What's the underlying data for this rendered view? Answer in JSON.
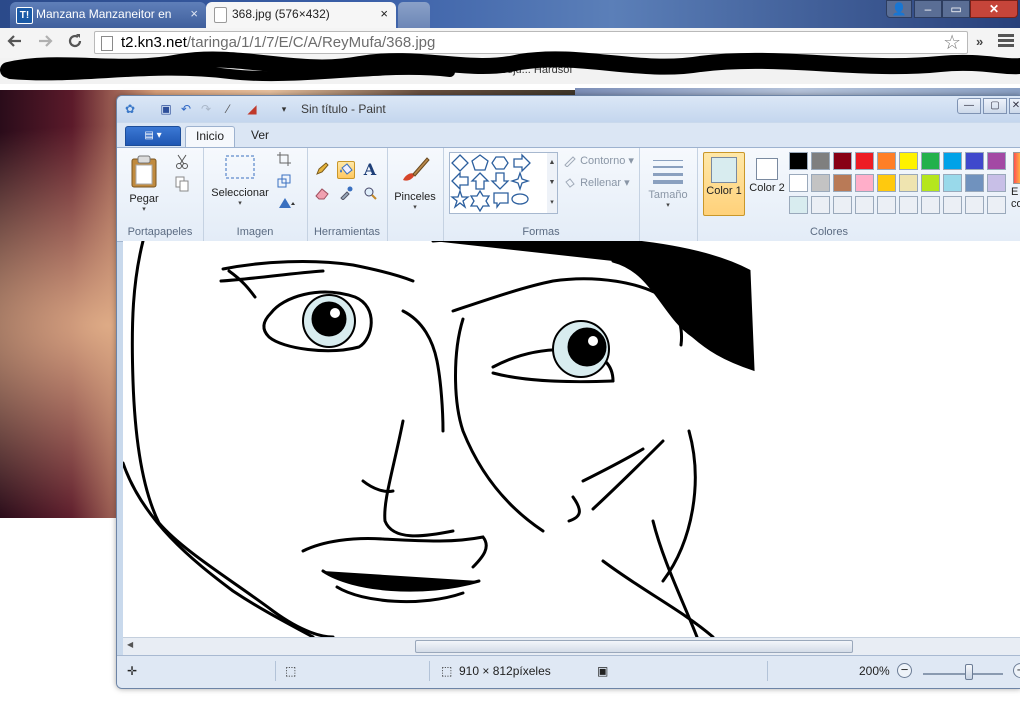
{
  "browser": {
    "tabs": [
      {
        "title": "Manzana Manzaneitor en",
        "favicon": "T!",
        "close": "×"
      },
      {
        "title": "368.jpg (576×432)",
        "close": "×"
      }
    ],
    "window_controls": {
      "user": "👤",
      "minimize": "–",
      "maximize": "▭",
      "close": "✕"
    },
    "url_host": "t2.kn3.net",
    "url_path": "/taringa/1/1/7/E/C/A/ReyMufa/368.jpg",
    "star_icon": "☆",
    "overflow": "»",
    "bookmark_partial": "e Videoju...      Hardsof"
  },
  "paint": {
    "title": "Sin título - Paint",
    "quick_access": {
      "app": "✿",
      "save": "▣",
      "undo": "↶",
      "redo": "↷",
      "picker": "⁄",
      "color": "◢",
      "more": "▾"
    },
    "window_controls": {
      "minimize": "—",
      "maximize": "▢",
      "close": "✕"
    },
    "menu_button": "▤ ▾",
    "tabs": {
      "home": "Inicio",
      "view": "Ver"
    },
    "groups": {
      "clipboard": {
        "label": "Portapapeles",
        "paste": "Pegar",
        "dropdown": "▾"
      },
      "image": {
        "label": "Imagen",
        "select": "Seleccionar",
        "dropdown": "▾"
      },
      "tools": {
        "label": "Herramientas",
        "text_tool": "A"
      },
      "brushes": {
        "label": "Pinceles",
        "dropdown": "▾"
      },
      "shapes": {
        "label": "Formas",
        "outline": "Contorno",
        "fill": "Rellenar",
        "outline_caret": "▾",
        "fill_caret": "▾"
      },
      "size": {
        "label": "Tamaño",
        "dropdown": "▾"
      },
      "colors": {
        "label": "Colores",
        "color1": "Color 1",
        "color2": "Color 2",
        "edit_partial": "E co"
      }
    },
    "palette": [
      "#000000",
      "#7f7f7f",
      "#880015",
      "#ed1c24",
      "#ff7f27",
      "#fff200",
      "#22b14c",
      "#00a2e8",
      "#3f48cc",
      "#a349a4",
      "#ffffff",
      "#c3c3c3",
      "#b97a57",
      "#ffaec9",
      "#ffc90e",
      "#efe4b0",
      "#b5e61d",
      "#99d9ea",
      "#7092be",
      "#c8bfe7",
      "#d8ecef",
      "#ebeff5",
      "#ebeff5",
      "#ebeff5",
      "#ebeff5",
      "#ebeff5",
      "#ebeff5",
      "#ebeff5",
      "#ebeff5",
      "#ebeff5"
    ],
    "colors_selected": {
      "color1": "#d8ecef",
      "color2": "#ffffff"
    },
    "status": {
      "dimensions": "910 × 812píxeles",
      "zoom": "200%",
      "zoom_minus": "−",
      "zoom_plus": "+",
      "cursor": "✛",
      "selection": "⬚",
      "save": "▣"
    }
  }
}
